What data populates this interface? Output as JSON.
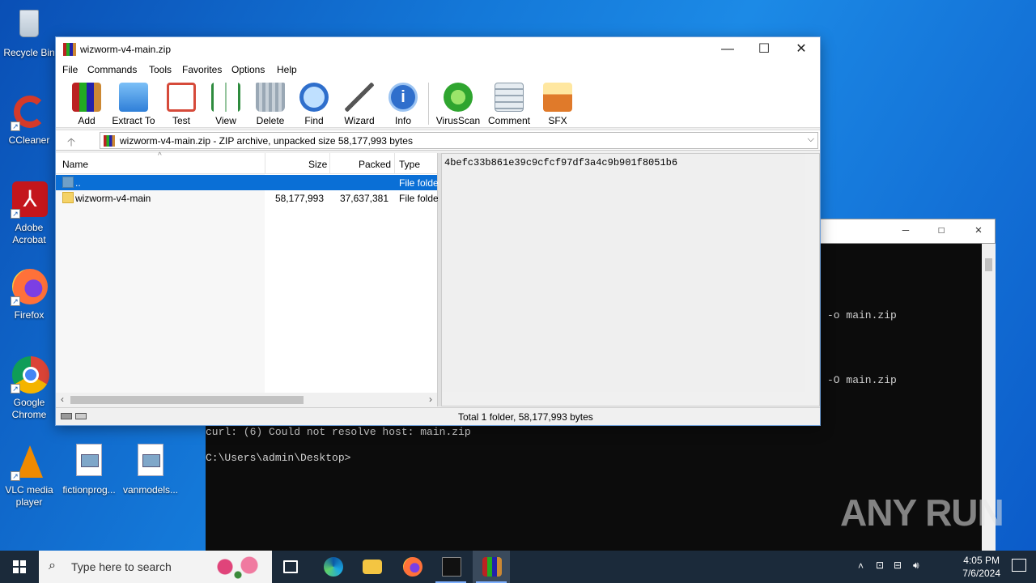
{
  "desktop": {
    "icons": [
      {
        "label": "Recycle Bin"
      },
      {
        "label": "CCleaner"
      },
      {
        "label": "Adobe Acrobat"
      },
      {
        "label": "Firefox"
      },
      {
        "label": "Google Chrome"
      },
      {
        "label": "VLC media player"
      },
      {
        "label": "fictionprog..."
      },
      {
        "label": "vanmodels..."
      }
    ]
  },
  "console": {
    "lines": [
      "-o main.zip",
      "-O main.zip",
      "curl: (6) Could not resolve host: main.zip",
      "C:\\Users\\admin\\Desktop>"
    ],
    "controls": {
      "minimize": "—",
      "maximize": "☐",
      "close": "✕"
    }
  },
  "winrar": {
    "title": "wizworm-v4-main.zip",
    "window_controls": {
      "minimize": "—",
      "maximize": "☐",
      "close": "✕"
    },
    "menu": [
      "File",
      "Commands",
      "Tools",
      "Favorites",
      "Options",
      "Help"
    ],
    "toolbar": [
      {
        "label": "Add",
        "icon": "add-archive-icon",
        "color": "#c0392b"
      },
      {
        "label": "Extract To",
        "icon": "extract-folder-icon",
        "color": "#3b8de0"
      },
      {
        "label": "Test",
        "icon": "test-checklist-icon",
        "color": "#d64a3a"
      },
      {
        "label": "View",
        "icon": "view-book-icon",
        "color": "#2e8b3e"
      },
      {
        "label": "Delete",
        "icon": "trash-icon",
        "color": "#8a9aa8"
      },
      {
        "label": "Find",
        "icon": "magnifier-icon",
        "color": "#2f6fcc"
      },
      {
        "label": "Wizard",
        "icon": "magic-wand-icon",
        "color": "#7a5ac8"
      },
      {
        "label": "Info",
        "icon": "info-icon",
        "color": "#2f6fcc"
      },
      {
        "label": "VirusScan",
        "icon": "virus-scan-icon",
        "color": "#2fa52f"
      },
      {
        "label": "Comment",
        "icon": "comment-icon",
        "color": "#8a9aa8"
      },
      {
        "label": "SFX",
        "icon": "sfx-box-icon",
        "color": "#e07a2a"
      }
    ],
    "address": "wizworm-v4-main.zip - ZIP archive, unpacked size 58,177,993 bytes",
    "columns": {
      "name": "Name",
      "size": "Size",
      "packed": "Packed",
      "type": "Type"
    },
    "rows": [
      {
        "name": "..",
        "size": "",
        "packed": "",
        "type": "File folde",
        "selected": true
      },
      {
        "name": "wizworm-v4-main",
        "size": "58,177,993",
        "packed": "37,637,381",
        "type": "File folde",
        "selected": false
      }
    ],
    "comment": "4befc33b861e39c9cfcf97df3a4c9b901f8051b6",
    "status": "Total 1 folder, 58,177,993 bytes"
  },
  "taskbar": {
    "search_placeholder": "Type here to search",
    "time": "4:05 PM",
    "date": "7/6/2024"
  },
  "watermark": "ANY RUN"
}
